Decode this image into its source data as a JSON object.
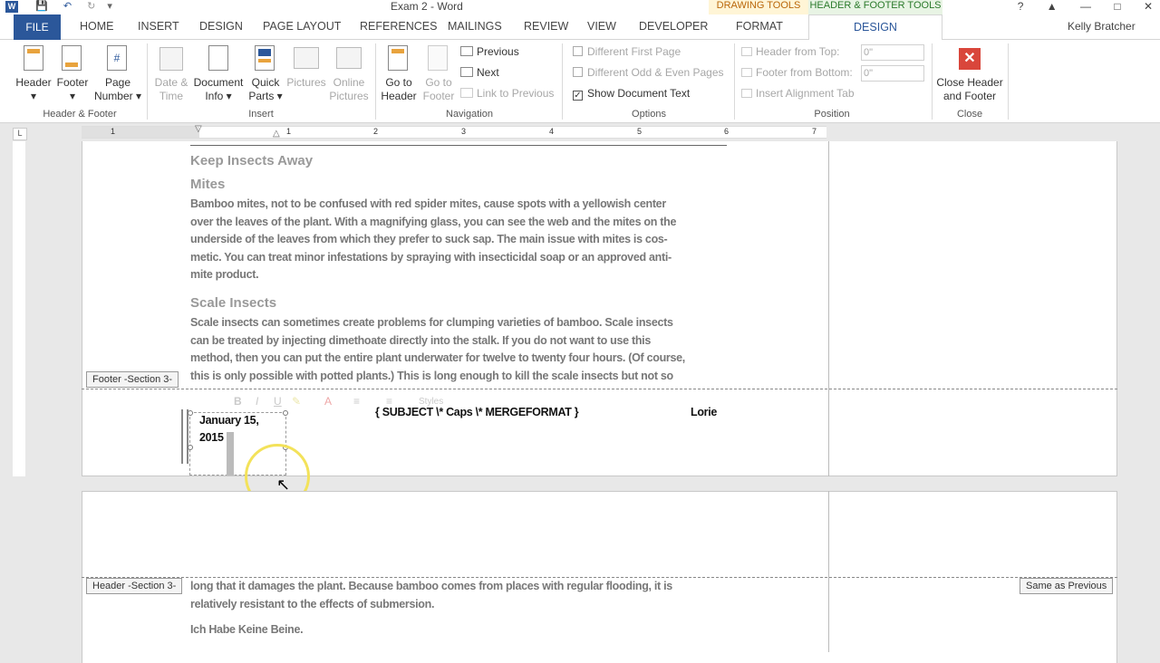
{
  "window": {
    "title": "Exam 2 - Word",
    "context_drawing": "DRAWING TOOLS",
    "context_hf": "HEADER & FOOTER TOOLS",
    "user": "Kelly Bratcher",
    "qat_help": "?"
  },
  "tabs": {
    "file": "FILE",
    "home": "HOME",
    "insert": "INSERT",
    "design": "DESIGN",
    "page_layout": "PAGE LAYOUT",
    "references": "REFERENCES",
    "mailings": "MAILINGS",
    "review": "REVIEW",
    "view": "VIEW",
    "developer": "DEVELOPER",
    "format": "FORMAT",
    "hf_design": "DESIGN"
  },
  "ribbon": {
    "header": "Header",
    "footer": "Footer",
    "page_number_1": "Page",
    "page_number_2": "Number",
    "group_hf": "Header & Footer",
    "date_time_1": "Date &",
    "date_time_2": "Time",
    "doc_info_1": "Document",
    "doc_info_2": "Info",
    "quick_parts_1": "Quick",
    "quick_parts_2": "Parts",
    "pictures": "Pictures",
    "online_pictures_1": "Online",
    "online_pictures_2": "Pictures",
    "group_insert": "Insert",
    "goto_header_1": "Go to",
    "goto_header_2": "Header",
    "goto_footer_1": "Go to",
    "goto_footer_2": "Footer",
    "previous": "Previous",
    "next": "Next",
    "link_previous": "Link to Previous",
    "group_nav": "Navigation",
    "diff_first": "Different First Page",
    "diff_odd_even": "Different Odd & Even Pages",
    "show_doc_text": "Show Document Text",
    "group_options": "Options",
    "header_from_top": "Header from Top:",
    "footer_from_bottom": "Footer from Bottom:",
    "spin_value_1": "0\"",
    "spin_value_2": "0\"",
    "insert_alignment": "Insert Alignment Tab",
    "group_position": "Position",
    "close_1": "Close Header",
    "close_2": "and Footer",
    "group_close": "Close"
  },
  "ruler": {
    "numbers": [
      "1",
      "1",
      "2",
      "3",
      "4",
      "5",
      "6",
      "7"
    ],
    "tab_selector": "L"
  },
  "document": {
    "heading_keep": "Keep Insects Away",
    "heading_mites": "Mites",
    "mites_lines": [
      "Bamboo mites, not to be confused with red spider mites, cause spots with a yellowish center",
      "over the leaves of the plant. With a magnifying glass, you can see the web and the mites on the",
      "underside of the leaves from which they prefer to suck sap. The main issue with mites is cos-",
      "metic. You can treat minor infestations by spraying with insecticidal soap or an approved anti-",
      "mite product."
    ],
    "heading_scale": "Scale Insects",
    "scale_lines": [
      "Scale insects can sometimes create problems for clumping varieties of bamboo. Scale insects",
      "can be treated by injecting dimethoate directly into the stalk. If you do not want to use this",
      "method, then you can put the entire plant underwater for twelve to twenty four hours. (Of course,",
      "this is only possible with potted plants.) This is long enough to kill the scale insects but not so"
    ],
    "footer_label": "Footer -Section 3-",
    "footer_date_1": "January 15,",
    "footer_date_2": "2015",
    "footer_field": "{ SUBJECT  \\* Caps  \\* MERGEFORMAT }",
    "footer_right": "Lorie",
    "header_label": "Header -Section 3-",
    "same_as_previous": "Same as Previous",
    "page2_lines": [
      "long that it damages the plant. Because bamboo comes from places with regular flooding, it is",
      "relatively resistant to the effects of submersion."
    ],
    "page2_heading": "Ich Habe Keine Beine."
  },
  "mini_toolbar": {
    "styles": "Styles"
  },
  "colors": {
    "accent": "#2b579a",
    "drawing_tools": "#b9670a",
    "hf_tools": "#2b7a2b",
    "close_red": "#d9463b"
  }
}
